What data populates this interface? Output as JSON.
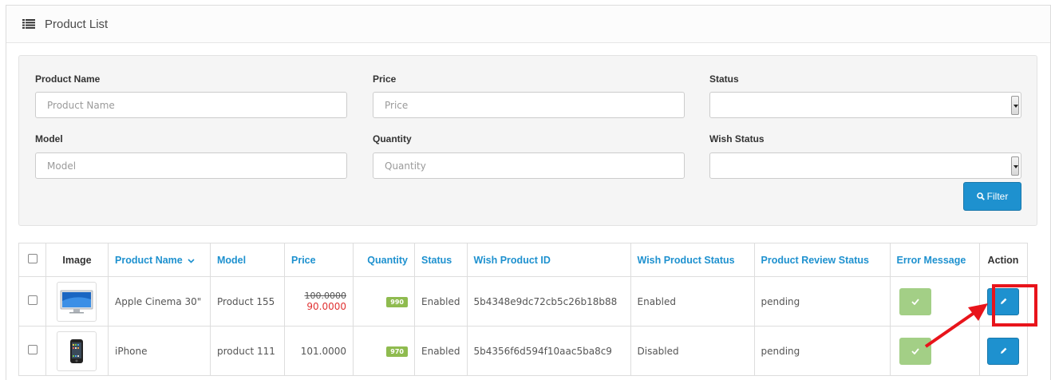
{
  "panel": {
    "title": "Product List",
    "icon": "list-icon"
  },
  "filters": {
    "product_name": {
      "label": "Product Name",
      "placeholder": "Product Name",
      "value": ""
    },
    "price": {
      "label": "Price",
      "placeholder": "Price",
      "value": ""
    },
    "status": {
      "label": "Status",
      "selected": ""
    },
    "model": {
      "label": "Model",
      "placeholder": "Model",
      "value": ""
    },
    "quantity": {
      "label": "Quantity",
      "placeholder": "Quantity",
      "value": ""
    },
    "wish_status": {
      "label": "Wish Status",
      "selected": ""
    },
    "filter_button": {
      "label": "Filter",
      "icon": "search-icon"
    }
  },
  "table": {
    "headers": {
      "image": "Image",
      "product_name": "Product Name",
      "model": "Model",
      "price": "Price",
      "quantity": "Quantity",
      "status": "Status",
      "wish_product_id": "Wish Product ID",
      "wish_product_status": "Wish Product Status",
      "product_review_status": "Product Review Status",
      "error_message": "Error Message",
      "action": "Action"
    },
    "rows": [
      {
        "name": "Apple Cinema 30\"",
        "model": "Product 155",
        "price_old": "100.0000",
        "price_special": "90.0000",
        "quantity": "990",
        "status": "Enabled",
        "wish_id": "5b4348e9dc72cb5c26b18b88",
        "wish_status": "Enabled",
        "review_status": "pending",
        "image_icon": "monitor-icon"
      },
      {
        "name": "iPhone",
        "model": "product 111",
        "price": "101.0000",
        "quantity": "970",
        "status": "Enabled",
        "wish_id": "5b4356f6d594f10aac5ba8c9",
        "wish_status": "Disabled",
        "review_status": "pending",
        "image_icon": "phone-icon"
      }
    ]
  },
  "colors": {
    "primary": "#1e91cf",
    "success_light": "#a3cf86",
    "quantity_badge": "#8fbb4f",
    "special_price": "#e03131",
    "annotation": "#e8141b"
  }
}
